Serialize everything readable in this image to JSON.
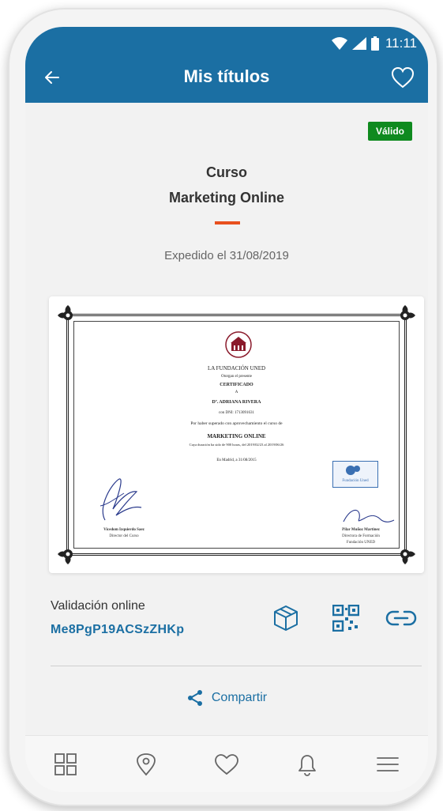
{
  "status_bar": {
    "time": "11:11",
    "icons": [
      "wifi-icon",
      "signal-icon",
      "battery-icon"
    ]
  },
  "header": {
    "title": "Mis títulos",
    "back_icon": "arrow-left-icon",
    "favorite_icon": "heart-outline-icon"
  },
  "status_badge": {
    "label": "Válido",
    "color": "#0f8a1f"
  },
  "course": {
    "type": "Curso",
    "name": "Marketing Online",
    "issued_text": "Expedido el 31/08/2019"
  },
  "certificate": {
    "issuer": "LA FUNDACIÓN UNED",
    "grants": "Otorgan el presente",
    "title": "CERTIFICADO",
    "to": "A",
    "recipient": "Dª. ADRIANA RIVERA",
    "id_line": "con DNI: 1713091631",
    "reason": "Por haber superado con aprovechamiento el curso de",
    "course": "MARKETING ONLINE",
    "duration": "Cuya duración ha sido de 900 horas, del 2019/02/23 al 2019/06/26",
    "place_date": "En Madrid, a 31/08/2015",
    "left_signatory": "Vicedom Izquierdo Saez",
    "left_role": "Director del Curso",
    "right_signatory": "Pilar Muñoz Martinez",
    "right_role": "Directora de Formación",
    "right_org": "Fundación UNED",
    "stamp_text": "Fundación Uned"
  },
  "validation": {
    "label": "Validación online",
    "code": "Me8PgP19ACSzZHKp",
    "actions": [
      "box-3d-icon",
      "qr-code-icon",
      "link-icon"
    ]
  },
  "share": {
    "label": "Compartir",
    "icon": "share-icon"
  },
  "bottom_nav": {
    "items": [
      "grid-icon",
      "location-pin-icon",
      "heart-outline-icon",
      "bell-icon",
      "menu-icon"
    ]
  },
  "colors": {
    "brand": "#1b6fa3",
    "accent": "#e8501e",
    "valid": "#0f8a1f"
  }
}
